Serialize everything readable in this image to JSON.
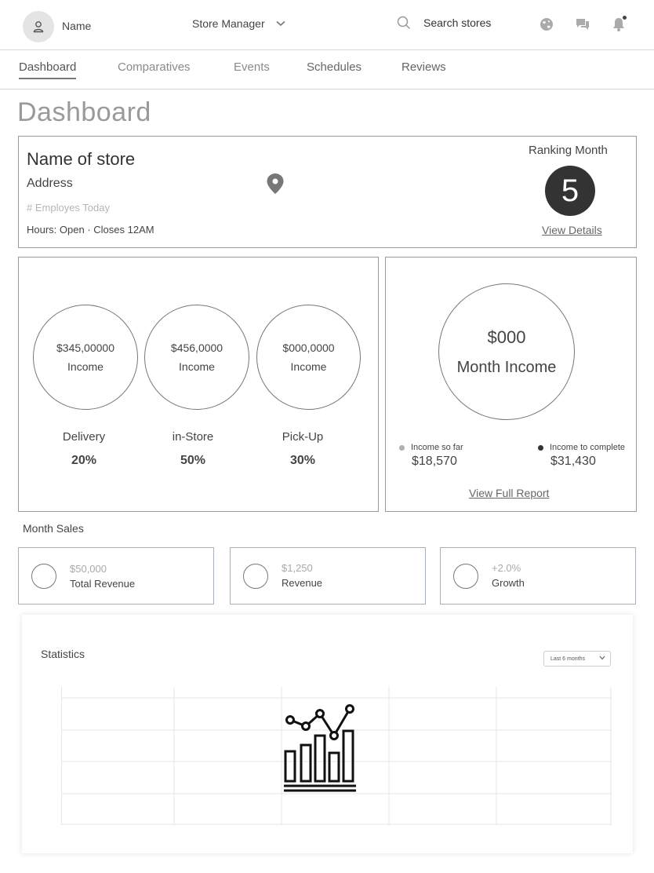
{
  "header": {
    "user_name": "Name",
    "role": "Store Manager",
    "search_label": "Search stores"
  },
  "tabs": [
    {
      "label": "Dashboard",
      "active": true
    },
    {
      "label": "Comparatives",
      "active": false
    },
    {
      "label": "Events",
      "active": false
    },
    {
      "label": "Schedules",
      "active": false
    },
    {
      "label": "Reviews",
      "active": false
    }
  ],
  "page_title": "Dashboard",
  "store": {
    "name": "Name of store",
    "address": "Address",
    "employees": "# Employes Today",
    "hours": "Hours:  Open  · Closes 12AM",
    "ranking_label": "Ranking Month",
    "ranking_value": "5",
    "view_details": "View Details"
  },
  "income": [
    {
      "amount": "$345,00000",
      "caption": "Income",
      "label": "Delivery",
      "percent": "20%"
    },
    {
      "amount": "$456,0000",
      "caption": "Income",
      "label": "in-Store",
      "percent": "50%"
    },
    {
      "amount": "$000,0000",
      "caption": "Income",
      "label": "Pick-Up",
      "percent": "30%"
    }
  ],
  "month_income": {
    "amount": "$000",
    "label": "Month Income",
    "so_far_label": "Income so far",
    "so_far_value": "$18,570",
    "to_complete_label": "Income to complete",
    "to_complete_value": "$31,430",
    "full_report": "View Full Report"
  },
  "month_sales": {
    "label": "Month Sales",
    "cards": [
      {
        "value": "$50,000",
        "label": "Total Revenue"
      },
      {
        "value": "$1,250",
        "label": "Revenue"
      },
      {
        "value": "+2.0%",
        "label": "Growth"
      }
    ]
  },
  "statistics": {
    "title": "Statistics",
    "period": "Last 6 months"
  },
  "colors": {
    "accent_dark": "#333333",
    "legend_light": "#b0b0b0",
    "legend_dark": "#333333"
  },
  "icons": [
    "user-icon",
    "chevron-down-icon",
    "search-icon",
    "globe-icon",
    "chat-icon",
    "bell-icon",
    "location-pin-icon",
    "chart-icon"
  ]
}
